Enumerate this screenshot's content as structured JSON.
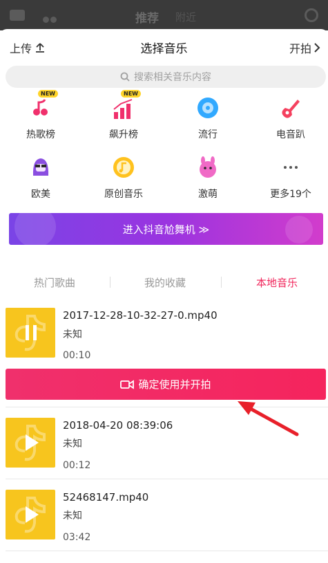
{
  "background_app": {
    "tab_recommend": "推荐",
    "tab_nearby": "附近"
  },
  "header": {
    "upload_label": "上传",
    "title": "选择音乐",
    "start_label": "开拍"
  },
  "search": {
    "placeholder": "搜索相关音乐内容"
  },
  "categories": [
    {
      "label": "热歌榜",
      "badge": "NEW",
      "icon": "hot-chart-icon",
      "color": "#f0306c"
    },
    {
      "label": "飙升榜",
      "badge": "NEW",
      "icon": "rising-chart-icon",
      "color": "#f0306c"
    },
    {
      "label": "流行",
      "icon": "pop-disc-icon",
      "color": "#31a9ff"
    },
    {
      "label": "电音趴",
      "icon": "electric-guitar-icon",
      "color": "#f5415f"
    },
    {
      "label": "欧美",
      "icon": "western-avatar-icon",
      "color": "#8a4ee0"
    },
    {
      "label": "原创音乐",
      "icon": "original-music-icon",
      "color": "#ffc21e"
    },
    {
      "label": "激萌",
      "icon": "cute-pet-icon",
      "color": "#f06ac6"
    },
    {
      "label": "更多19个",
      "icon": "more-dots-icon",
      "color": "#555555"
    }
  ],
  "banner": {
    "label": "进入抖音尬舞机 ≫"
  },
  "tabs": [
    {
      "label": "热门歌曲",
      "active": false
    },
    {
      "label": "我的收藏",
      "active": false
    },
    {
      "label": "本地音乐",
      "active": true
    }
  ],
  "songs": [
    {
      "name": "2017-12-28-10-32-27-0.mp40",
      "artist": "未知",
      "duration": "00:10",
      "state": "pause-icon"
    },
    {
      "name": "2018-04-20 08:39:06",
      "artist": "未知",
      "duration": "00:12",
      "state": "play-icon"
    },
    {
      "name": "52468147.mp40",
      "artist": "未知",
      "duration": "03:42",
      "state": "play-icon"
    }
  ],
  "confirm_button": {
    "label": "确定使用并开拍"
  },
  "colors": {
    "accent": "#f0245a",
    "cover": "#f7c51e",
    "annotation_arrow": "#e8202a"
  }
}
